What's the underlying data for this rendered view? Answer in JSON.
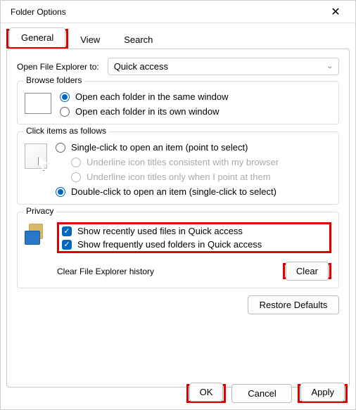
{
  "window": {
    "title": "Folder Options"
  },
  "tabs": {
    "general": "General",
    "view": "View",
    "search": "Search"
  },
  "openExplorer": {
    "label": "Open File Explorer to:",
    "value": "Quick access"
  },
  "browse": {
    "legend": "Browse folders",
    "same": "Open each folder in the same window",
    "own": "Open each folder in its own window"
  },
  "click": {
    "legend": "Click items as follows",
    "single": "Single-click to open an item (point to select)",
    "underlineBrowser": "Underline icon titles consistent with my browser",
    "underlinePoint": "Underline icon titles only when I point at them",
    "double": "Double-click to open an item (single-click to select)"
  },
  "privacy": {
    "legend": "Privacy",
    "showRecent": "Show recently used files in Quick access",
    "showFrequent": "Show frequently used folders in Quick access",
    "clearLabel": "Clear File Explorer history",
    "clearBtn": "Clear"
  },
  "restore": "Restore Defaults",
  "footer": {
    "ok": "OK",
    "cancel": "Cancel",
    "apply": "Apply"
  }
}
